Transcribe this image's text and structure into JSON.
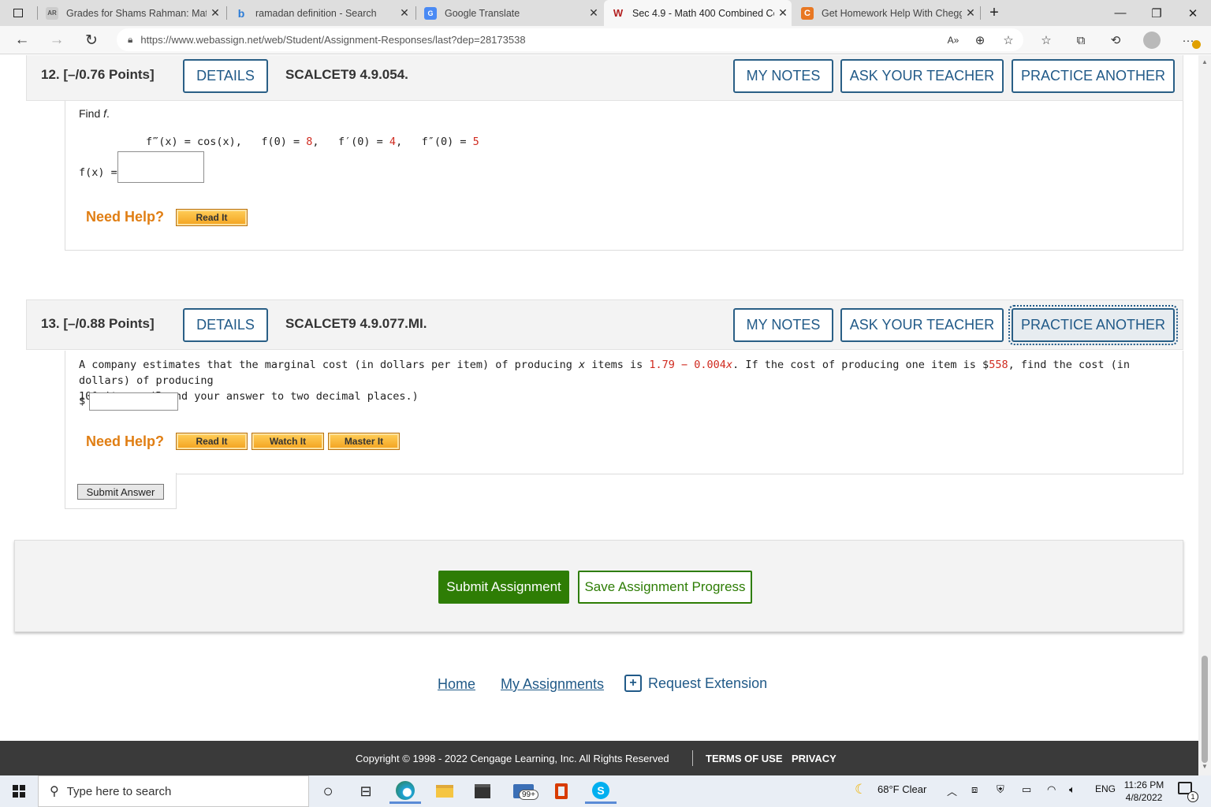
{
  "browser": {
    "tabs": [
      {
        "title": "Grades for Shams Rahman: Math",
        "icon": "webassign-grades-icon"
      },
      {
        "title": "ramadan definition - Search",
        "icon": "bing-icon"
      },
      {
        "title": "Google Translate",
        "icon": "google-translate-icon"
      },
      {
        "title": "Sec 4.9 - Math 400 Combined Co",
        "icon": "webassign-icon"
      },
      {
        "title": "Get Homework Help With Chegg",
        "icon": "chegg-icon"
      }
    ],
    "new_tab_symbol": "+",
    "url": "https://www.webassign.net/web/Student/Assignment-Responses/last?dep=28173538",
    "accent": "#e87722"
  },
  "q12": {
    "number": "12.",
    "points": "[–/0.76 Points]",
    "details": "DETAILS",
    "code": "SCALCET9 4.9.054.",
    "my_notes": "MY NOTES",
    "ask_teacher": "ASK YOUR TEACHER",
    "practice_another": "PRACTICE ANOTHER",
    "prompt_lead": "Find ",
    "prompt_var": "f",
    "prompt_end": ".",
    "eq_lhs": "f‴(x) = cos(x),",
    "eq_f0_lhs": "f(0) = ",
    "eq_f0_val": "8",
    "eq_f1_lhs": "f′(0) = ",
    "eq_f1_val": "4",
    "eq_f2_lhs": "f″(0) = ",
    "eq_f2_val": "5",
    "comma": ",",
    "answer_label": "f(x) =",
    "need_help": "Need Help?",
    "read_it": "Read It"
  },
  "q13": {
    "number": "13.",
    "points": "[–/0.88 Points]",
    "details": "DETAILS",
    "code": "SCALCET9 4.9.077.MI.",
    "my_notes": "MY NOTES",
    "ask_teacher": "ASK YOUR TEACHER",
    "practice_another": "PRACTICE ANOTHER",
    "text_1": "A company estimates that the marginal cost (in dollars per item) of producing ",
    "text_x": "x",
    "text_2": " items is ",
    "expr_red": "1.79 − 0.004",
    "expr_x": "x",
    "text_3": ". If the cost of producing one item is $",
    "cost_red": "558",
    "text_4": ", find the cost (in dollars) of producing",
    "text_5": "100 items. (Round your answer to two decimal places.)",
    "currency": "$",
    "need_help": "Need Help?",
    "read_it": "Read It",
    "watch_it": "Watch It",
    "master_it": "Master It"
  },
  "submit_answer": "Submit Answer",
  "submit_assignment": "Submit Assignment",
  "save_progress": "Save Assignment Progress",
  "footer": {
    "home": "Home",
    "my_assignments": "My Assignments",
    "request_extension": "Request Extension",
    "copyright": "Copyright © 1998 - 2022 Cengage Learning, Inc. All Rights Reserved",
    "terms": "TERMS OF USE",
    "privacy": "PRIVACY"
  },
  "taskbar": {
    "search_placeholder": "Type here to search",
    "mail_badge": "99+",
    "weather": "68°F  Clear",
    "language": "ENG",
    "time": "11:26 PM",
    "date": "4/8/2022",
    "notification_count": "1"
  }
}
